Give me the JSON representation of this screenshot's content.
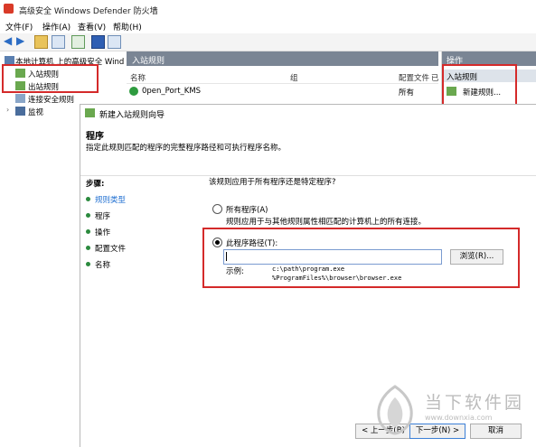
{
  "window": {
    "title": "高级安全 Windows Defender 防火墙"
  },
  "menu": {
    "items": [
      "文件(F)",
      "操作(A)",
      "查看(V)",
      "帮助(H)"
    ]
  },
  "tree": {
    "root": "本地计算机 上的高级安全 Wind",
    "items": [
      "入站规则",
      "出站规则",
      "连接安全规则",
      "监视"
    ]
  },
  "list": {
    "header": "入站规则",
    "columns": [
      "名称",
      "组",
      "配置文件",
      "已"
    ],
    "rows": [
      {
        "name": "0pen_Port_KMS",
        "profile": "所有"
      }
    ]
  },
  "actions": {
    "header": "操作",
    "section": "入站规则",
    "items": [
      "新建规则..."
    ]
  },
  "wizard": {
    "title": "新建入站规则向导",
    "heading": "程序",
    "description": "指定此规则匹配的程序的完整程序路径和可执行程序名称。",
    "steps_label": "步骤:",
    "steps": [
      "规则类型",
      "程序",
      "操作",
      "配置文件",
      "名称"
    ],
    "question": "该规则应用于所有程序还是特定程序?",
    "all_programs": {
      "label": "所有程序(A)",
      "desc": "规则应用于与其他规则属性相匹配的计算机上的所有连接。"
    },
    "this_program": {
      "label": "此程序路径(T):"
    },
    "path_value": "",
    "browse_label": "浏览(R)...",
    "example_label": "示例:",
    "example_lines": [
      "c:\\path\\program.exe",
      "%ProgramFiles%\\browser\\browser.exe"
    ],
    "buttons": {
      "back": "< 上一步(B)",
      "next": "下一步(N) >",
      "cancel": "取消"
    }
  },
  "watermark": {
    "brand": "当下软件园",
    "url": "www.downxia.com"
  },
  "colors": {
    "red_highlight": "#d42a2a",
    "header_gray": "#7a8594",
    "selected_step": "#1f6fd1"
  }
}
